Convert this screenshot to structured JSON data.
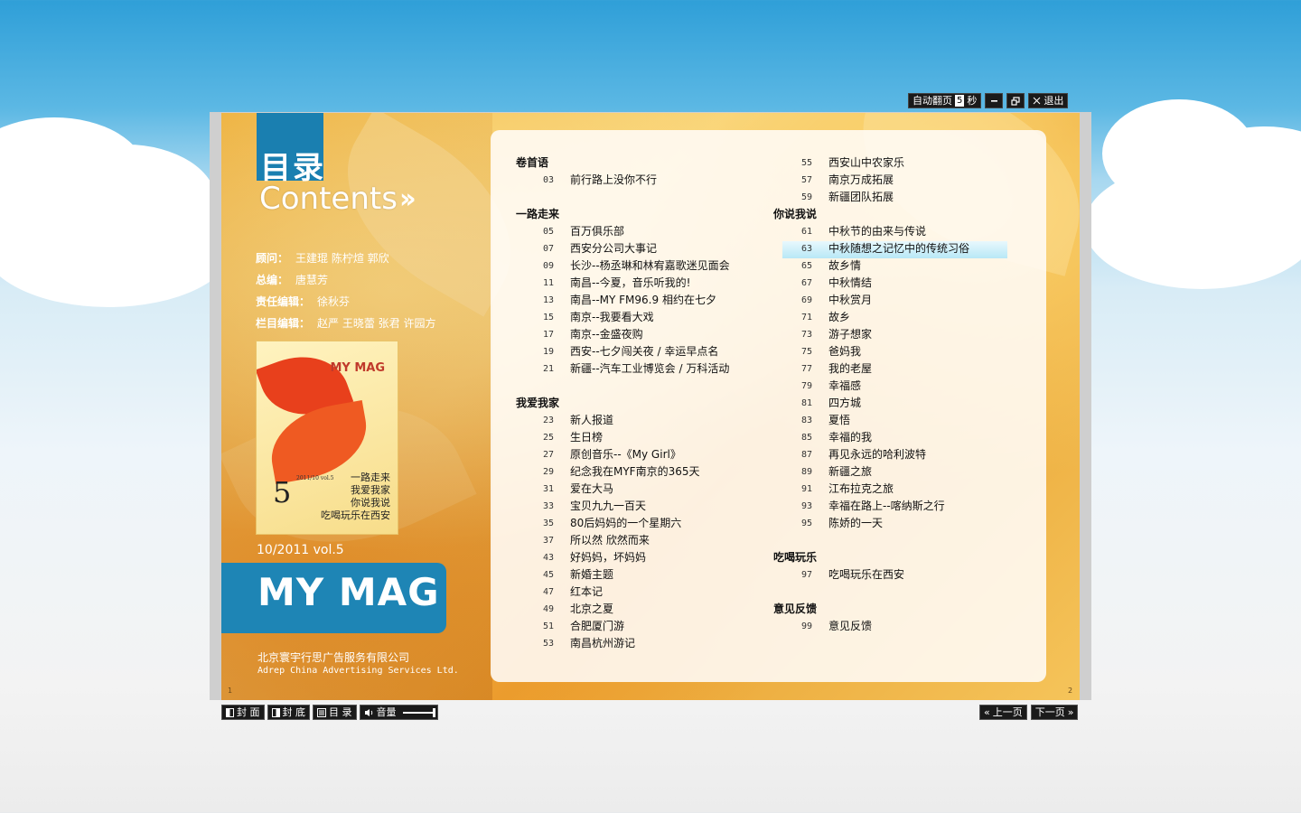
{
  "toolbar": {
    "auto_flip_label": "自动翻页",
    "auto_flip_value": "5",
    "auto_flip_unit": "秒",
    "minimize_icon": "minus-icon",
    "restore_icon": "restore-icon",
    "exit_label": "退出"
  },
  "left_page": {
    "title_cn": "目录",
    "title_en": "Contents",
    "credits": [
      {
        "label": "顾问：",
        "value": "王建琨 陈柠煊 郭欣"
      },
      {
        "label": "总编：",
        "value": "唐慧芳"
      },
      {
        "label": "责任编辑：",
        "value": "徐秋芬"
      },
      {
        "label": "栏目编辑：",
        "value": "赵严 王晓蕾 张君 许园方"
      }
    ],
    "cover": {
      "logo": "MY MAG",
      "issue_number": "5",
      "issue_sub": "2011/10 vol.5",
      "calligraphy": [
        "一路走来",
        "我爱我家",
        "你说我说",
        "吃喝玩乐在西安"
      ]
    },
    "issue": "10/2011  vol.5",
    "brand": "MY MAG",
    "company_cn": "北京寰宇行思广告服务有限公司",
    "company_en": "Adrep China Advertising Services Ltd.",
    "page_left": "1",
    "page_right": "2"
  },
  "toc": {
    "left_column": [
      {
        "section": "卷首语",
        "items": [
          {
            "page": "03",
            "title": "前行路上没你不行"
          }
        ]
      },
      {
        "section": "一路走来",
        "items": [
          {
            "page": "05",
            "title": "百万俱乐部"
          },
          {
            "page": "07",
            "title": "西安分公司大事记"
          },
          {
            "page": "09",
            "title": "长沙--杨丞琳和林宥嘉歌迷见面会"
          },
          {
            "page": "11",
            "title": "南昌--今夏，音乐听我的!"
          },
          {
            "page": "13",
            "title": "南昌--MY FM96.9 相约在七夕"
          },
          {
            "page": "15",
            "title": "南京--我要看大戏"
          },
          {
            "page": "17",
            "title": "南京--金盛夜购"
          },
          {
            "page": "19",
            "title": "西安--七夕闯关夜 / 幸运早点名"
          },
          {
            "page": "21",
            "title": "新疆--汽车工业博览会 / 万科活动"
          }
        ]
      },
      {
        "section": "我爱我家",
        "items": [
          {
            "page": "23",
            "title": "新人报道"
          },
          {
            "page": "25",
            "title": "生日榜"
          },
          {
            "page": "27",
            "title": "原创音乐--《My Girl》"
          },
          {
            "page": "29",
            "title": "纪念我在MYF南京的365天"
          },
          {
            "page": "31",
            "title": "爱在大马"
          },
          {
            "page": "33",
            "title": "宝贝九九一百天"
          },
          {
            "page": "35",
            "title": "80后妈妈的一个星期六"
          },
          {
            "page": "37",
            "title": "所以然 欣然而来"
          },
          {
            "page": "43",
            "title": "好妈妈，坏妈妈"
          },
          {
            "page": "45",
            "title": "新婚主题"
          },
          {
            "page": "47",
            "title": "红本记"
          },
          {
            "page": "49",
            "title": "北京之夏"
          },
          {
            "page": "51",
            "title": "合肥厦门游"
          },
          {
            "page": "53",
            "title": "南昌杭州游记"
          }
        ]
      }
    ],
    "right_column": [
      {
        "section": "",
        "items": [
          {
            "page": "55",
            "title": "西安山中农家乐"
          },
          {
            "page": "57",
            "title": "南京万成拓展"
          },
          {
            "page": "59",
            "title": "新疆团队拓展"
          }
        ]
      },
      {
        "section": "你说我说",
        "items": [
          {
            "page": "61",
            "title": "中秋节的由来与传说"
          },
          {
            "page": "63",
            "title": "中秋随想之记忆中的传统习俗"
          },
          {
            "page": "65",
            "title": "故乡情"
          },
          {
            "page": "67",
            "title": "中秋情结"
          },
          {
            "page": "69",
            "title": "中秋赏月"
          },
          {
            "page": "71",
            "title": "故乡"
          },
          {
            "page": "73",
            "title": "游子想家"
          },
          {
            "page": "75",
            "title": "爸妈我"
          },
          {
            "page": "77",
            "title": "我的老屋"
          },
          {
            "page": "79",
            "title": "幸福感"
          },
          {
            "page": "81",
            "title": "四方城"
          },
          {
            "page": "83",
            "title": "夏悟"
          },
          {
            "page": "85",
            "title": "幸福的我"
          },
          {
            "page": "87",
            "title": "再见永远的哈利波特"
          },
          {
            "page": "89",
            "title": "新疆之旅"
          },
          {
            "page": "91",
            "title": "江布拉克之旅"
          },
          {
            "page": "93",
            "title": "幸福在路上--喀纳斯之行"
          },
          {
            "page": "95",
            "title": "陈娇的一天"
          }
        ]
      },
      {
        "section": "吃喝玩乐",
        "items": [
          {
            "page": "97",
            "title": "吃喝玩乐在西安"
          }
        ]
      },
      {
        "section": "意见反馈",
        "items": [
          {
            "page": "99",
            "title": "意见反馈"
          }
        ]
      }
    ]
  },
  "bottom_toolbar": {
    "cover_label": "封 面",
    "back_cover_label": "封 底",
    "toc_label": "目 录",
    "volume_label": "音量",
    "volume_level": 1.0,
    "prev_label": "上一页",
    "next_label": "下一页"
  }
}
